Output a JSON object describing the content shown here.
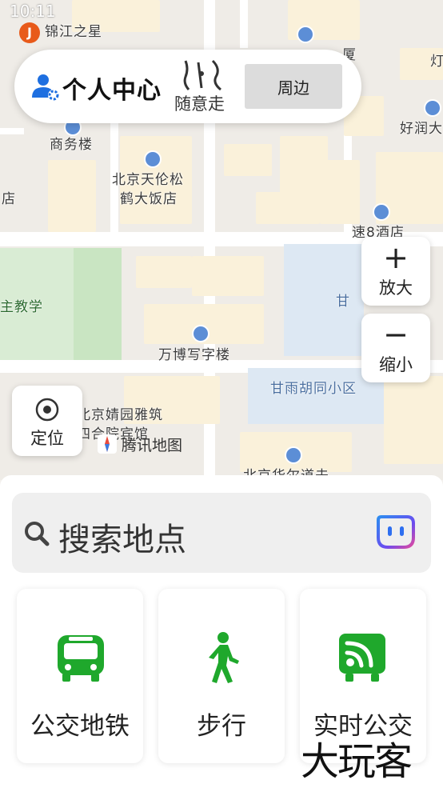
{
  "status_bar": {
    "time": "10:11"
  },
  "map": {
    "labels": {
      "jinjiang": "锦江之星",
      "commerce": "商务楼",
      "tianlunsong_1": "北京天伦松",
      "tianlunsong_2": "鹤大饭店",
      "dian": "店",
      "speed8": "速8酒店",
      "teaching": "主教学",
      "gan": "甘",
      "wanbo": "万博写字楼",
      "ganyu": "甘雨胡同小区",
      "jingyuan_1": "北京婧园雅筑",
      "jingyuan_2": "四合院宾馆",
      "runda": "好润大",
      "xia": "厦",
      "deng": "灯",
      "bottom_cut": "北京华尔道夫"
    },
    "provider_logo": "腾讯地图"
  },
  "top_card": {
    "title": "个人中心",
    "walk_label": "随意走",
    "nearby_label": "周边"
  },
  "zoom": {
    "zoom_in_label": "放大",
    "zoom_out_label": "缩小",
    "plus": "+",
    "minus": "−"
  },
  "locate": {
    "label": "定位"
  },
  "search": {
    "placeholder": "搜索地点"
  },
  "cards": [
    {
      "label": "公交地铁",
      "icon": "bus-icon"
    },
    {
      "label": "步行",
      "icon": "walking-person-icon"
    },
    {
      "label": "实时公交",
      "icon": "realtime-bus-icon"
    }
  ],
  "watermark": "大玩客",
  "colors": {
    "accent_green": "#1fa82c",
    "accent_blue": "#1e6fe0",
    "map_bg": "#efece7"
  }
}
